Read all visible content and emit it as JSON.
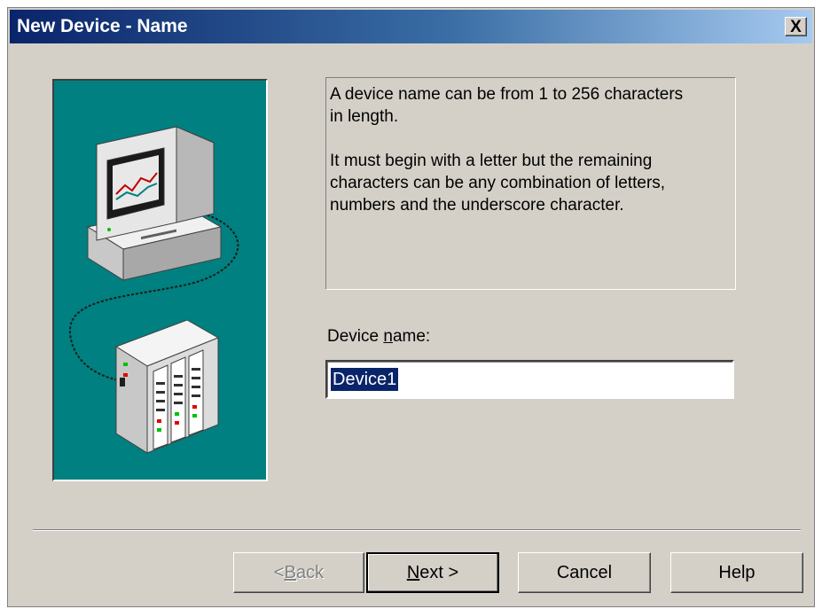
{
  "window": {
    "title": "New Device - Name",
    "close_glyph": "X"
  },
  "info": {
    "paragraph1": "A device name can be from 1 to 256 characters\nin length.",
    "paragraph2": "It must begin with a letter but the remaining\ncharacters can be any combination of letters,\nnumbers and the underscore character."
  },
  "device_name": {
    "label_before": "Device ",
    "label_accel": "n",
    "label_after": "ame:",
    "value": "Device1"
  },
  "buttons": {
    "back": {
      "prefix": "< ",
      "accel": "B",
      "rest": "ack",
      "enabled": false
    },
    "next": {
      "accel": "N",
      "rest": "ext >"
    },
    "cancel": {
      "label": "Cancel"
    },
    "help": {
      "label": "Help"
    }
  },
  "colors": {
    "title_gradient_start": "#0a246a",
    "illustration_bg": "#008080",
    "dialog_bg": "#d4d0c8",
    "selection": "#0a246a"
  },
  "icons": [
    "computer-icon",
    "plc-rack-icon",
    "close-icon"
  ]
}
